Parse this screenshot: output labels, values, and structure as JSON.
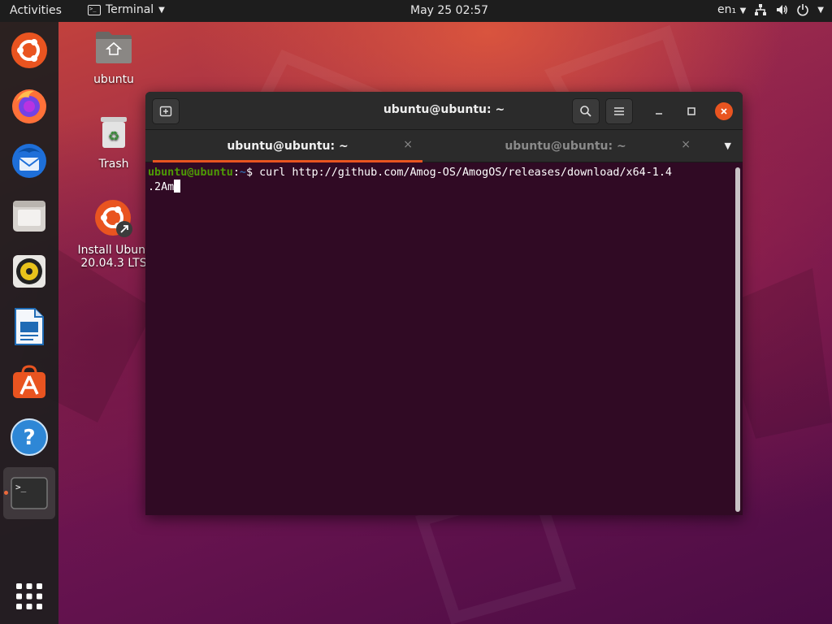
{
  "topbar": {
    "activities": "Activities",
    "app_name": "Terminal",
    "clock": "May 25  02:57",
    "language": "en₁"
  },
  "dock": {
    "items": [
      {
        "name": "Install Ubuntu"
      },
      {
        "name": "Firefox"
      },
      {
        "name": "Thunderbird"
      },
      {
        "name": "Files"
      },
      {
        "name": "Rhythmbox"
      },
      {
        "name": "LibreOffice Writer"
      },
      {
        "name": "Ubuntu Software"
      },
      {
        "name": "Help"
      },
      {
        "name": "Terminal"
      }
    ],
    "show_apps": "Show Applications"
  },
  "desktop": {
    "icons": [
      {
        "label": "ubuntu"
      },
      {
        "label": "Trash"
      },
      {
        "label_line1": "Install Ubunt",
        "label_line2": "20.04.3 LTS"
      }
    ]
  },
  "terminal": {
    "title": "ubuntu@ubuntu: ~",
    "tabs": [
      {
        "label": "ubuntu@ubuntu: ~",
        "active": true
      },
      {
        "label": "ubuntu@ubuntu: ~",
        "active": false
      }
    ],
    "tab_close": "×",
    "prompt_user": "ubuntu@ubuntu",
    "prompt_sep": ":",
    "prompt_path": "~",
    "prompt_symbol": "$ ",
    "command_line1": "curl http://github.com/Amog-OS/AmogOS/releases/download/x64-1.4",
    "command_line2": ".2Am"
  },
  "colors": {
    "accent": "#e95420",
    "terminal_bg": "#300a24",
    "prompt_user": "#4e9a06",
    "prompt_path": "#3465a4"
  }
}
